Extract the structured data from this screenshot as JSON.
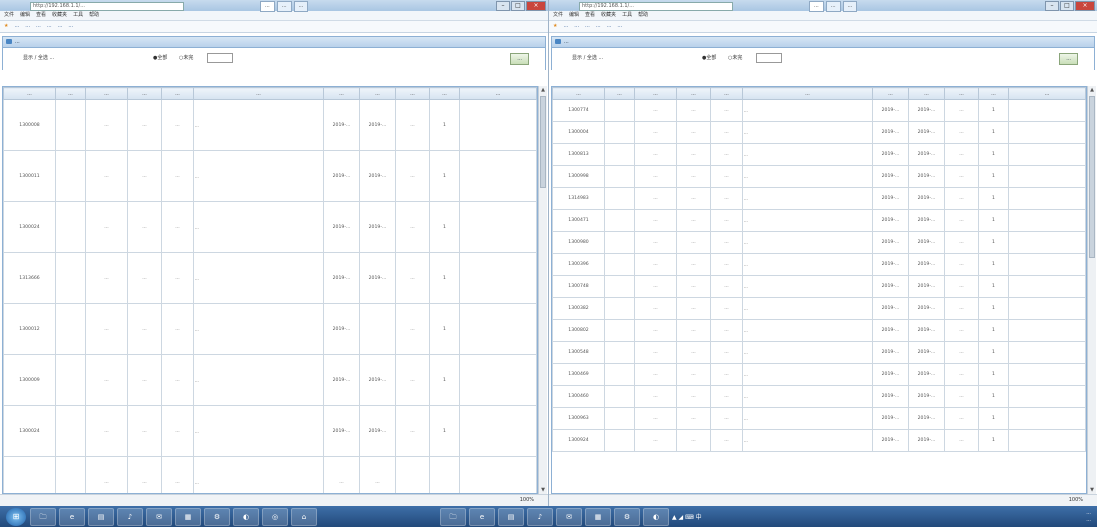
{
  "left": {
    "window_title": "http://192.168.1.1/...",
    "tabs": [
      "...",
      "...",
      "..."
    ],
    "menu": [
      "文件",
      "编辑",
      "查看",
      "收藏夹",
      "工具",
      "帮助"
    ],
    "favorites": [
      "...",
      "...",
      "...",
      "...",
      "...",
      "..."
    ],
    "panel_title": "...",
    "filter_label": "显示 / 全选 ...",
    "radio_a": "●全部",
    "radio_b": "○未完",
    "query_button": "...",
    "columns": [
      "...",
      "...",
      "...",
      "...",
      "...",
      "...",
      "...",
      "...",
      "...",
      "...",
      "..."
    ],
    "rows": [
      {
        "id": "1300008",
        "c2": "",
        "c3": "...",
        "c4": "...",
        "c5": "...",
        "desc": "...",
        "c7": "2019-...",
        "c8": "2019-...",
        "c9": "...",
        "c10": "1"
      },
      {
        "id": "1300011",
        "c2": "",
        "c3": "...",
        "c4": "...",
        "c5": "...",
        "desc": "...",
        "c7": "2019-...",
        "c8": "2019-...",
        "c9": "...",
        "c10": "1"
      },
      {
        "id": "1300024",
        "c2": "",
        "c3": "...",
        "c4": "...",
        "c5": "...",
        "desc": "...",
        "c7": "2019-...",
        "c8": "2019-...",
        "c9": "...",
        "c10": "1"
      },
      {
        "id": "1313666",
        "c2": "",
        "c3": "...",
        "c4": "...",
        "c5": "...",
        "desc": "...",
        "c7": "2019-...",
        "c8": "2019-...",
        "c9": "...",
        "c10": "1"
      },
      {
        "id": "1300012",
        "c2": "",
        "c3": "...",
        "c4": "...",
        "c5": "...",
        "desc": "...",
        "c7": "2019-...",
        "c8": "",
        "c9": "...",
        "c10": "1"
      },
      {
        "id": "1300009",
        "c2": "",
        "c3": "...",
        "c4": "...",
        "c5": "...",
        "desc": "...",
        "c7": "2019-...",
        "c8": "2019-...",
        "c9": "...",
        "c10": "1"
      },
      {
        "id": "1300024",
        "c2": "",
        "c3": "...",
        "c4": "...",
        "c5": "...",
        "desc": "...",
        "c7": "2019-...",
        "c8": "2019-...",
        "c9": "...",
        "c10": "1"
      },
      {
        "id": "",
        "c2": "",
        "c3": "...",
        "c4": "...",
        "c5": "...",
        "desc": "...",
        "c7": "...",
        "c8": "...",
        "c9": "",
        "c10": ""
      }
    ],
    "zoom": "100%"
  },
  "right": {
    "window_title": "http://192.168.1.1/...",
    "tabs": [
      "...",
      "...",
      "..."
    ],
    "menu": [
      "文件",
      "编辑",
      "查看",
      "收藏夹",
      "工具",
      "帮助"
    ],
    "favorites": [
      "...",
      "...",
      "...",
      "...",
      "...",
      "..."
    ],
    "panel_title": "...",
    "filter_label": "显示 / 全选 ...",
    "radio_a": "●全部",
    "radio_b": "○未完",
    "query_button": "...",
    "columns": [
      "...",
      "...",
      "...",
      "...",
      "...",
      "...",
      "...",
      "...",
      "...",
      "...",
      "..."
    ],
    "rows": [
      {
        "id": "1300774",
        "c2": "",
        "c3": "...",
        "c4": "...",
        "c5": "...",
        "desc": "...",
        "c7": "2019-...",
        "c8": "2019-...",
        "c9": "...",
        "c10": "1"
      },
      {
        "id": "1300004",
        "c2": "",
        "c3": "...",
        "c4": "...",
        "c5": "...",
        "desc": "...",
        "c7": "2019-...",
        "c8": "2019-...",
        "c9": "...",
        "c10": "1"
      },
      {
        "id": "1300813",
        "c2": "",
        "c3": "...",
        "c4": "...",
        "c5": "...",
        "desc": "...",
        "c7": "2019-...",
        "c8": "2019-...",
        "c9": "...",
        "c10": "1"
      },
      {
        "id": "1300998",
        "c2": "",
        "c3": "...",
        "c4": "...",
        "c5": "...",
        "desc": "...",
        "c7": "2019-...",
        "c8": "2019-...",
        "c9": "...",
        "c10": "1"
      },
      {
        "id": "1314983",
        "c2": "",
        "c3": "...",
        "c4": "...",
        "c5": "...",
        "desc": "...",
        "c7": "2019-...",
        "c8": "2019-...",
        "c9": "...",
        "c10": "1"
      },
      {
        "id": "1300471",
        "c2": "",
        "c3": "...",
        "c4": "...",
        "c5": "...",
        "desc": "...",
        "c7": "2019-...",
        "c8": "2019-...",
        "c9": "...",
        "c10": "1"
      },
      {
        "id": "1300980",
        "c2": "",
        "c3": "...",
        "c4": "...",
        "c5": "...",
        "desc": "...",
        "c7": "2019-...",
        "c8": "2019-...",
        "c9": "...",
        "c10": "1"
      },
      {
        "id": "1300396",
        "c2": "",
        "c3": "...",
        "c4": "...",
        "c5": "...",
        "desc": "...",
        "c7": "2019-...",
        "c8": "2019-...",
        "c9": "...",
        "c10": "1"
      },
      {
        "id": "1300748",
        "c2": "",
        "c3": "...",
        "c4": "...",
        "c5": "...",
        "desc": "...",
        "c7": "2019-...",
        "c8": "2019-...",
        "c9": "...",
        "c10": "1"
      },
      {
        "id": "1300382",
        "c2": "",
        "c3": "...",
        "c4": "...",
        "c5": "...",
        "desc": "...",
        "c7": "2019-...",
        "c8": "2019-...",
        "c9": "...",
        "c10": "1"
      },
      {
        "id": "1300802",
        "c2": "",
        "c3": "...",
        "c4": "...",
        "c5": "...",
        "desc": "...",
        "c7": "2019-...",
        "c8": "2019-...",
        "c9": "...",
        "c10": "1"
      },
      {
        "id": "1300548",
        "c2": "",
        "c3": "...",
        "c4": "...",
        "c5": "...",
        "desc": "...",
        "c7": "2019-...",
        "c8": "2019-...",
        "c9": "...",
        "c10": "1"
      },
      {
        "id": "1300469",
        "c2": "",
        "c3": "...",
        "c4": "...",
        "c5": "...",
        "desc": "...",
        "c7": "2019-...",
        "c8": "2019-...",
        "c9": "...",
        "c10": "1"
      },
      {
        "id": "1300460",
        "c2": "",
        "c3": "...",
        "c4": "...",
        "c5": "...",
        "desc": "...",
        "c7": "2019-...",
        "c8": "2019-...",
        "c9": "...",
        "c10": "1"
      },
      {
        "id": "1300963",
        "c2": "",
        "c3": "...",
        "c4": "...",
        "c5": "...",
        "desc": "...",
        "c7": "2019-...",
        "c8": "2019-...",
        "c9": "...",
        "c10": "1"
      },
      {
        "id": "1300924",
        "c2": "",
        "c3": "...",
        "c4": "...",
        "c5": "...",
        "desc": "...",
        "c7": "2019-...",
        "c8": "2019-...",
        "c9": "...",
        "c10": "1"
      }
    ],
    "zoom": "100%"
  },
  "taskbar": {
    "apps": [
      "🗀",
      "e",
      "▤",
      "♪",
      "✉",
      "▦",
      "⚙",
      "◐",
      "◎",
      "⌂"
    ],
    "right_apps": [
      "🗀",
      "e",
      "▤",
      "♪",
      "✉",
      "▦",
      "⚙",
      "◐"
    ],
    "tray_icons": "▲ ◢ ⌨ 中",
    "clock_time": "...",
    "clock_date": "..."
  }
}
